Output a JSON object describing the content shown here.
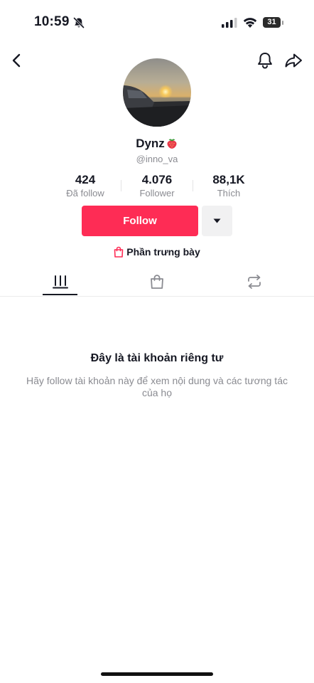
{
  "status_bar": {
    "time": "10:59",
    "battery": "31",
    "icons": [
      "bell-slash-icon",
      "signal-icon",
      "wifi-icon",
      "battery-icon"
    ]
  },
  "nav": {
    "icons": [
      "chevron-left-icon",
      "bell-icon",
      "share-icon"
    ]
  },
  "profile": {
    "display_name": "Dynz",
    "username": "@inno_va",
    "stats": [
      {
        "value": "424",
        "label": "Đã follow"
      },
      {
        "value": "4.076",
        "label": "Follower"
      },
      {
        "value": "88,1K",
        "label": "Thích"
      }
    ],
    "follow_label": "Follow",
    "showcase_label": "Phần trưng bày"
  },
  "tabs": {
    "icons": [
      "videos-grid-icon",
      "shopping-bag-icon",
      "repost-icon"
    ],
    "active": 0
  },
  "private": {
    "title": "Đây là tài khoản riêng tư",
    "description": "Hãy follow tài khoản này để xem nội dung và các tương tác của họ"
  },
  "colors": {
    "accent": "#fe2c55",
    "text": "#161823",
    "muted": "#8a8b91",
    "secondary_bg": "#f1f1f2"
  }
}
